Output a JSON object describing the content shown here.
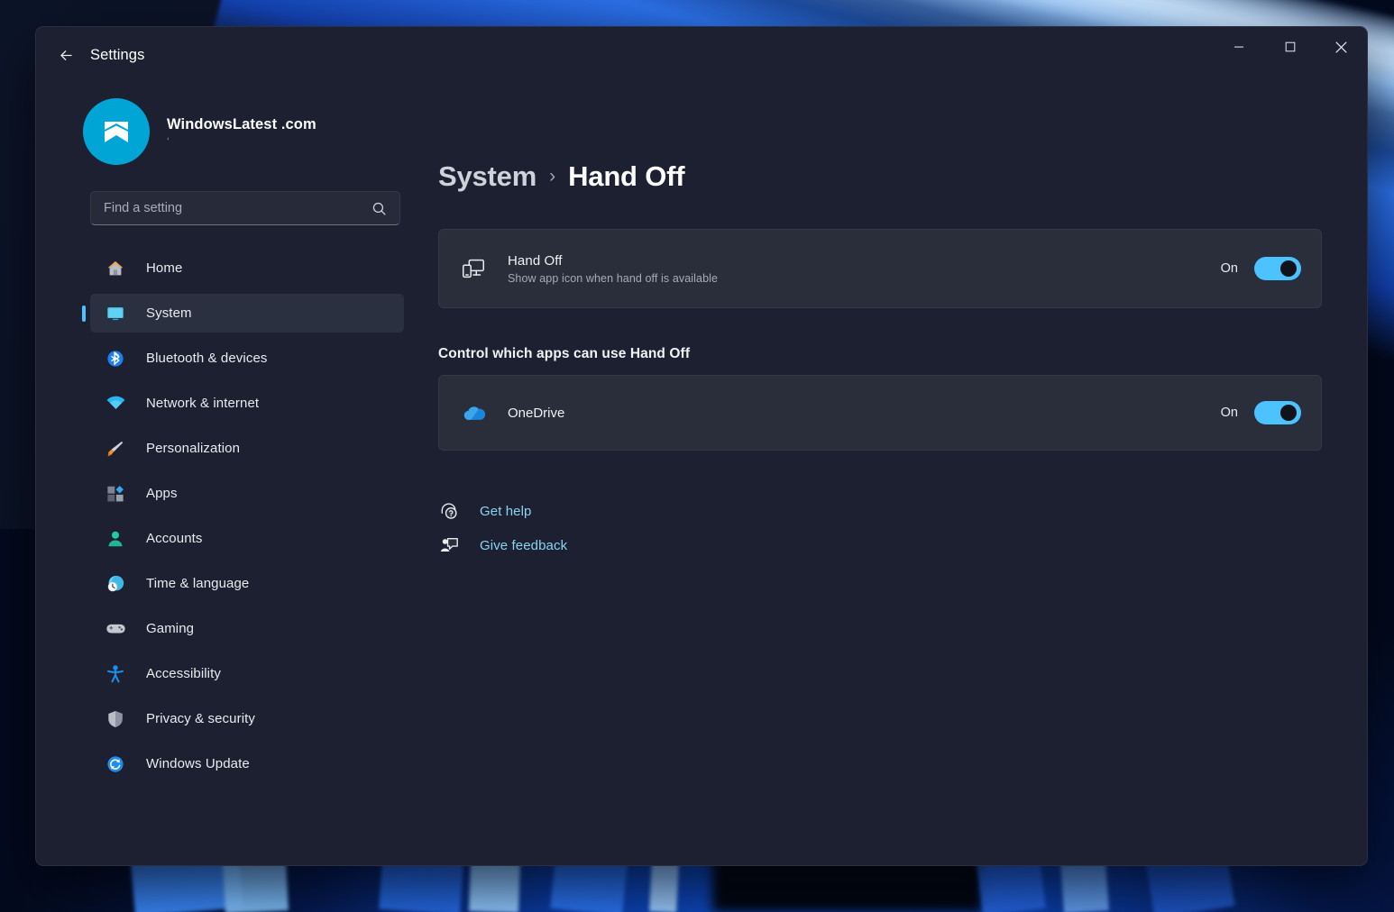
{
  "window": {
    "title": "Settings",
    "back_icon": "back-arrow-icon",
    "controls": {
      "minimize": "minimize-icon",
      "maximize": "maximize-icon",
      "close": "close-icon"
    }
  },
  "account": {
    "name": "WindowsLatest .com",
    "sub": "‘"
  },
  "search": {
    "placeholder": "Find a setting",
    "value": "",
    "icon": "search-icon"
  },
  "sidebar": {
    "items": [
      {
        "label": "Home",
        "icon": "home-icon",
        "selected": false
      },
      {
        "label": "System",
        "icon": "system-monitor-icon",
        "selected": true
      },
      {
        "label": "Bluetooth & devices",
        "icon": "bluetooth-icon",
        "selected": false
      },
      {
        "label": "Network & internet",
        "icon": "wifi-icon",
        "selected": false
      },
      {
        "label": "Personalization",
        "icon": "paintbrush-icon",
        "selected": false
      },
      {
        "label": "Apps",
        "icon": "apps-icon",
        "selected": false
      },
      {
        "label": "Accounts",
        "icon": "person-icon",
        "selected": false
      },
      {
        "label": "Time & language",
        "icon": "clock-globe-icon",
        "selected": false
      },
      {
        "label": "Gaming",
        "icon": "gamepad-icon",
        "selected": false
      },
      {
        "label": "Accessibility",
        "icon": "accessibility-person-icon",
        "selected": false
      },
      {
        "label": "Privacy & security",
        "icon": "shield-icon",
        "selected": false
      },
      {
        "label": "Windows Update",
        "icon": "update-refresh-icon",
        "selected": false
      }
    ]
  },
  "breadcrumb": {
    "parent": "System",
    "separator": "›",
    "current": "Hand Off"
  },
  "handoff_card": {
    "icon": "monitor-phone-icon",
    "title": "Hand Off",
    "subtitle": "Show app icon when hand off is available",
    "toggle_label": "On",
    "toggle_state": "on"
  },
  "apps_section": {
    "heading": "Control which apps can use Hand Off",
    "rows": [
      {
        "name": "OneDrive",
        "icon": "onedrive-cloud-icon",
        "toggle_label": "On",
        "toggle_state": "on"
      }
    ]
  },
  "links": [
    {
      "label": "Get help",
      "icon": "get-help-icon"
    },
    {
      "label": "Give feedback",
      "icon": "give-feedback-icon"
    }
  ],
  "colors": {
    "accent": "#4cc2ff",
    "link": "#8ad4f2",
    "card_bg": "#2a2e3b",
    "window_bg": "#1c2030",
    "avatar_bg": "#00a5d6"
  }
}
